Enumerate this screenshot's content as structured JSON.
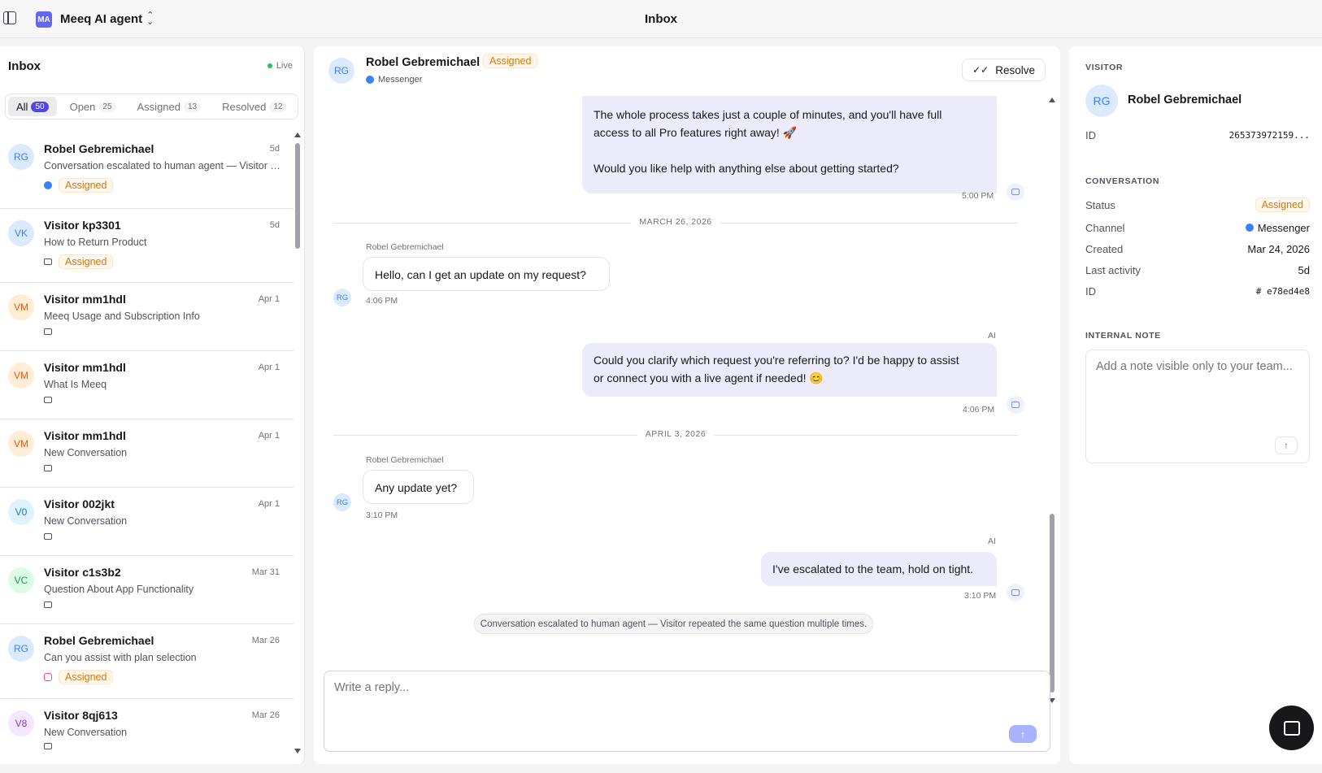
{
  "topbar": {
    "workspace_initials": "MA",
    "workspace_name": "Meeq AI agent",
    "title": "Inbox"
  },
  "inbox": {
    "title": "Inbox",
    "live_label": "Live",
    "tabs": [
      {
        "label": "All",
        "count": "50"
      },
      {
        "label": "Open",
        "count": "25"
      },
      {
        "label": "Assigned",
        "count": "13"
      },
      {
        "label": "Resolved",
        "count": "12"
      }
    ],
    "conversations": [
      {
        "initials": "RG",
        "name": "Robel Gebremichael",
        "time": "5d",
        "preview": "Conversation escalated to human agent — Visitor repeated the same question multiple times.",
        "channel": "messenger",
        "status": "Assigned"
      },
      {
        "initials": "VK",
        "name": "Visitor kp3301",
        "time": "5d",
        "preview": "How to Return Product",
        "channel": "chat",
        "status": "Assigned"
      },
      {
        "initials": "VM",
        "name": "Visitor mm1hdl",
        "time": "Apr 1",
        "preview": "Meeq Usage and Subscription Info",
        "channel": "chat",
        "status": ""
      },
      {
        "initials": "VM",
        "name": "Visitor mm1hdl",
        "time": "Apr 1",
        "preview": "What Is Meeq",
        "channel": "chat",
        "status": ""
      },
      {
        "initials": "VM",
        "name": "Visitor mm1hdl",
        "time": "Apr 1",
        "preview": "New Conversation",
        "channel": "chat",
        "status": ""
      },
      {
        "initials": "V0",
        "name": "Visitor 002jkt",
        "time": "Apr 1",
        "preview": "New Conversation",
        "channel": "chat",
        "status": ""
      },
      {
        "initials": "VC",
        "name": "Visitor c1s3b2",
        "time": "Mar 31",
        "preview": "Question About App Functionality",
        "channel": "chat",
        "status": ""
      },
      {
        "initials": "RG",
        "name": "Robel Gebremichael",
        "time": "Mar 26",
        "preview": "Can you assist with plan selection",
        "channel": "instagram",
        "status": "Assigned"
      },
      {
        "initials": "V8",
        "name": "Visitor 8qj613",
        "time": "Mar 26",
        "preview": "New Conversation",
        "channel": "chat",
        "status": ""
      }
    ]
  },
  "conversation": {
    "header": {
      "initials": "RG",
      "name": "Robel Gebremichael",
      "status": "Assigned",
      "channel": "Messenger",
      "resolve_label": "Resolve"
    },
    "messages": {
      "bot1_line1": "The whole process takes just a couple of minutes, and you'll have full",
      "bot1_line2": "access to all Pro features right away! 🚀",
      "bot1_line3": "Would you like help with anything else about getting started?",
      "bot1_time": "5:00 PM",
      "date1": "MARCH 26, 2026",
      "user1_sender": "Robel Gebremichael",
      "user1_text": "Hello, can I get an update on my request?",
      "user1_time": "4:06 PM",
      "bot2_sender": "AI",
      "bot2_line1": "Could you clarify which request you're referring to? I'd be happy to assist",
      "bot2_line2": "or connect you with a live agent if needed! 😊",
      "bot2_time": "4:06 PM",
      "date2": "APRIL 3, 2026",
      "user2_sender": "Robel Gebremichael",
      "user2_text": "Any update yet?",
      "user2_time": "3:10 PM",
      "bot3_sender": "AI",
      "bot3_text": "I've escalated to the team, hold on tight.",
      "bot3_time": "3:10 PM",
      "system": "Conversation escalated to human agent — Visitor repeated the same question multiple times."
    },
    "reply_placeholder": "Write a reply..."
  },
  "details": {
    "visitor_label": "VISITOR",
    "visitor_initials": "RG",
    "visitor_name": "Robel Gebremichael",
    "visitor_id_key": "ID",
    "visitor_id": "265373972159...",
    "conversation_label": "CONVERSATION",
    "status_key": "Status",
    "status": "Assigned",
    "channel_key": "Channel",
    "channel": "Messenger",
    "created_key": "Created",
    "created": "Mar 24, 2026",
    "last_activity_key": "Last activity",
    "last_activity": "5d",
    "conv_id_key": "ID",
    "conv_id": "# e78ed4e8",
    "note_label": "INTERNAL NOTE",
    "note_placeholder": "Add a note visible only to your team..."
  },
  "colors": {
    "accent": "#4f46e5",
    "assigned": "#d97706",
    "live": "#22c55e",
    "bot_bubble": "#ebebfa"
  },
  "icons": [
    "sidebar-toggle-icon",
    "chevron-updown-icon",
    "messenger-icon",
    "chat-icon",
    "instagram-icon",
    "check-icon",
    "bot-icon",
    "send-icon",
    "chat-bubble-icon"
  ]
}
